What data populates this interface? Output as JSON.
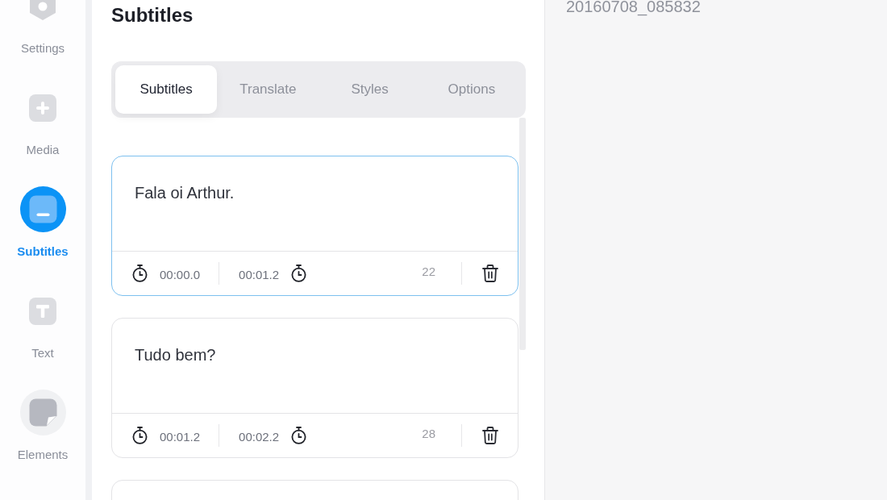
{
  "sidebar": {
    "items": [
      {
        "kind": "settings",
        "label": "Settings",
        "selected": false,
        "hovered": false
      },
      {
        "kind": "media",
        "label": "Media",
        "selected": false,
        "hovered": false
      },
      {
        "kind": "subtitles",
        "label": "Subtitles",
        "selected": true,
        "hovered": false
      },
      {
        "kind": "text",
        "label": "Text",
        "selected": false,
        "hovered": false
      },
      {
        "kind": "elements",
        "label": "Elements",
        "selected": false,
        "hovered": true
      }
    ]
  },
  "panel": {
    "title": "Subtitles",
    "tabs": [
      {
        "label": "Subtitles",
        "selected": true
      },
      {
        "label": "Translate",
        "selected": false
      },
      {
        "label": "Styles",
        "selected": false
      },
      {
        "label": "Options",
        "selected": false
      }
    ],
    "subtitles": [
      {
        "text": "Fala oi Arthur.",
        "start": "00:00.0",
        "end": "00:01.2",
        "count": "22",
        "selected": true
      },
      {
        "text": "Tudo bem?",
        "start": "00:01.2",
        "end": "00:02.2",
        "count": "28",
        "selected": false
      },
      {
        "selected": false
      }
    ]
  },
  "preview": {
    "file_name": "20160708_085832"
  }
}
